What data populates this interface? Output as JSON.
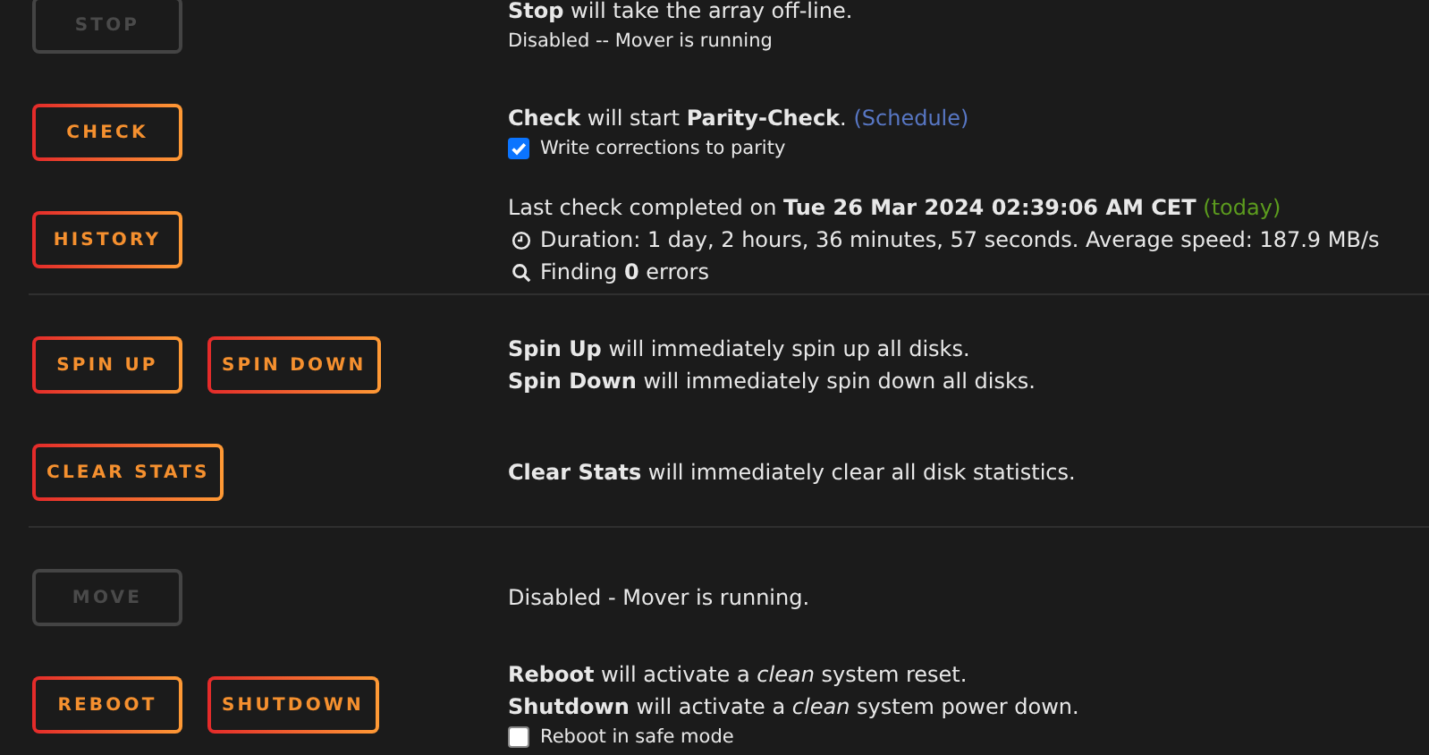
{
  "sections": [
    {
      "rows": [
        {
          "buttons": [
            {
              "label": "STOP",
              "disabled": true
            }
          ],
          "lines": [
            {
              "kind": "text",
              "text": "**Stop** will take the array off-line."
            },
            {
              "kind": "small",
              "text": "Disabled -- Mover is running"
            }
          ]
        },
        {
          "buttons": [
            {
              "label": "CHECK",
              "disabled": false
            }
          ],
          "lines": [
            {
              "kind": "text",
              "text": "**Check** will start **Parity-Check**.",
              "link": "(Schedule)"
            },
            {
              "kind": "checkbox",
              "text": "Write corrections to parity",
              "checked": true
            }
          ]
        },
        {
          "buttons": [
            {
              "label": "HISTORY",
              "disabled": false
            }
          ],
          "lines": [
            {
              "kind": "text",
              "text": "Last check completed on **Tue 26 Mar 2024 02:39:06 AM CET**",
              "highlight": "(today)"
            },
            {
              "kind": "clock",
              "text": "Duration: 1 day, 2 hours, 36 minutes, 57 seconds. Average speed: 187.9 MB/s"
            },
            {
              "kind": "search",
              "text": "Finding **0** errors"
            }
          ]
        }
      ]
    },
    {
      "rows": [
        {
          "buttons": [
            {
              "label": "SPIN UP",
              "disabled": false
            },
            {
              "label": "SPIN DOWN",
              "disabled": false
            }
          ],
          "lines": [
            {
              "kind": "text",
              "text": "**Spin Up** will immediately spin up all disks."
            },
            {
              "kind": "text",
              "text": "**Spin Down** will immediately spin down all disks."
            }
          ]
        },
        {
          "buttons": [
            {
              "label": "CLEAR STATS",
              "disabled": false
            }
          ],
          "lines": [
            {
              "kind": "text",
              "text": "**Clear Stats** will immediately clear all disk statistics."
            }
          ]
        }
      ]
    },
    {
      "rows": [
        {
          "buttons": [
            {
              "label": "MOVE",
              "disabled": true
            }
          ],
          "lines": [
            {
              "kind": "text",
              "text": "Disabled - Mover is running."
            }
          ]
        },
        {
          "buttons": [
            {
              "label": "REBOOT",
              "disabled": false
            },
            {
              "label": "SHUTDOWN",
              "disabled": false
            }
          ],
          "lines": [
            {
              "kind": "text",
              "text": "**Reboot** will activate a *clean* system reset."
            },
            {
              "kind": "text",
              "text": "**Shutdown** will activate a *clean* system power down."
            },
            {
              "kind": "checkbox",
              "text": "Reboot in safe mode",
              "checked": false
            }
          ]
        }
      ]
    }
  ]
}
